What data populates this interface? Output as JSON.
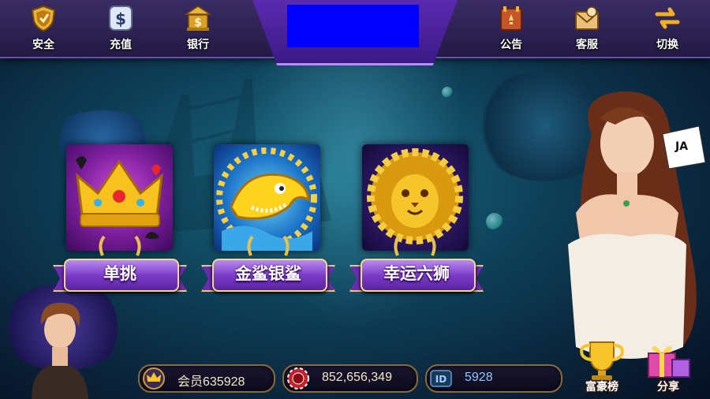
{
  "header": {
    "left_buttons": [
      {
        "label": "安全",
        "icon": "shield-icon"
      },
      {
        "label": "充值",
        "icon": "dollar-icon"
      },
      {
        "label": "银行",
        "icon": "bank-icon"
      }
    ],
    "right_buttons": [
      {
        "label": "公告",
        "icon": "notice-board-icon"
      },
      {
        "label": "客服",
        "icon": "mail-envelope-icon"
      },
      {
        "label": "切换",
        "icon": "switch-arrows-icon"
      }
    ],
    "logo_placeholder_color": "#0000ff"
  },
  "games": [
    {
      "label": "单挑",
      "icon": "crown-icon"
    },
    {
      "label": "金鲨银鲨",
      "icon": "golden-shark-icon"
    },
    {
      "label": "幸运六狮",
      "icon": "golden-lion-icon"
    }
  ],
  "footer": {
    "member_name": "会员635928",
    "coins": "852,656,349",
    "id_label": "ID",
    "id_value": "5928",
    "rank_label": "富豪榜",
    "share_label": "分享"
  },
  "colors": {
    "accent_purple": "#6a2cb0",
    "gold": "#f2d98a",
    "ocean": "#0e4159"
  }
}
